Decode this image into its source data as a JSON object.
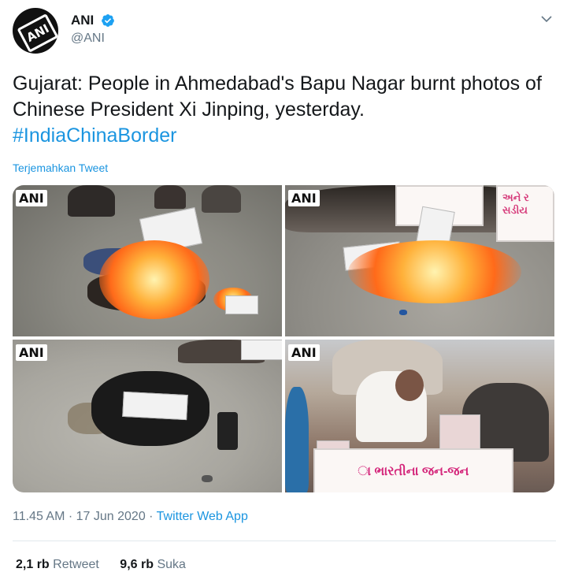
{
  "author": {
    "display_name": "ANI",
    "handle": "@ANI",
    "avatar_text": "ANI",
    "verified_color": "#1da1f2"
  },
  "tweet": {
    "text": "Gujarat: People in Ahmedabad's Bapu Nagar burnt photos of Chinese President Xi Jinping, yesterday.",
    "hashtag": "#IndiaChinaBorder",
    "translate_label": "Terjemahkan Tweet"
  },
  "media": {
    "watermark": "ANI",
    "photos": [
      {
        "banner_text": ""
      },
      {
        "banner_text": "અને ર\nસડીય"
      },
      {
        "banner_text": ""
      },
      {
        "banner_text": "ા ભારતીના જન-જન"
      }
    ]
  },
  "meta": {
    "time_date": "11.45 AM · 17 Jun 2020 · ",
    "source": "Twitter Web App"
  },
  "stats": {
    "retweets_count": "2,1 rb",
    "retweets_label": "Retweet",
    "likes_count": "9,6 rb",
    "likes_label": "Suka"
  },
  "colors": {
    "link": "#1b95e0",
    "muted": "#657786",
    "text": "#14171a"
  }
}
